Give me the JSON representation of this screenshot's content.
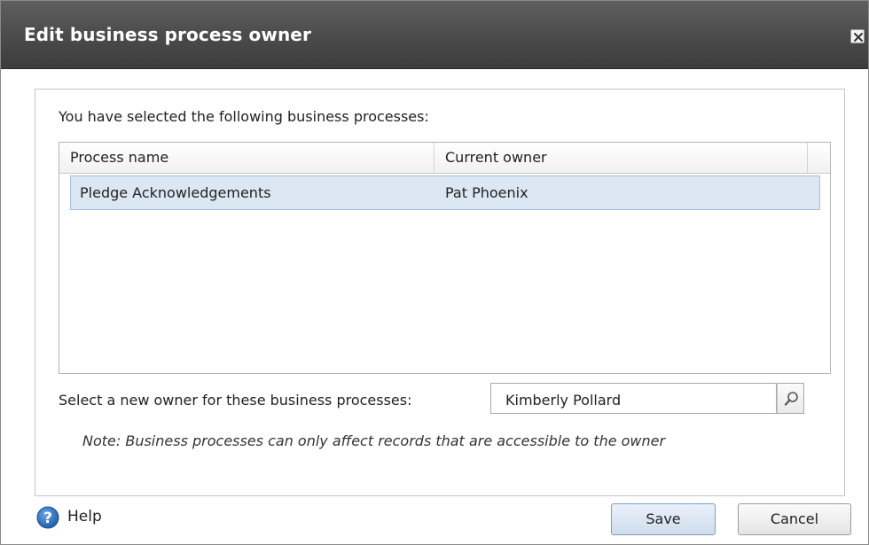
{
  "dialog": {
    "title": "Edit business process owner",
    "close_icon": "close-icon"
  },
  "selection": {
    "intro": "You have selected the following business processes:",
    "columns": [
      "Process name",
      "Current owner"
    ],
    "rows": [
      {
        "process_name": "Pledge Acknowledgements",
        "current_owner": "Pat  Phoenix"
      }
    ]
  },
  "owner": {
    "label": "Select a new owner for these business processes:",
    "value": "Kimberly Pollard",
    "search_icon": "search-icon"
  },
  "note": "Note: Business processes can only affect records that are accessible to the owner",
  "footer": {
    "help_label": "Help",
    "help_icon": "help-icon",
    "save_label": "Save",
    "cancel_label": "Cancel"
  },
  "colors": {
    "titlebar": "#4a4a4a",
    "selected_row": "#dce7f4",
    "help_icon": "#2f6db5"
  }
}
